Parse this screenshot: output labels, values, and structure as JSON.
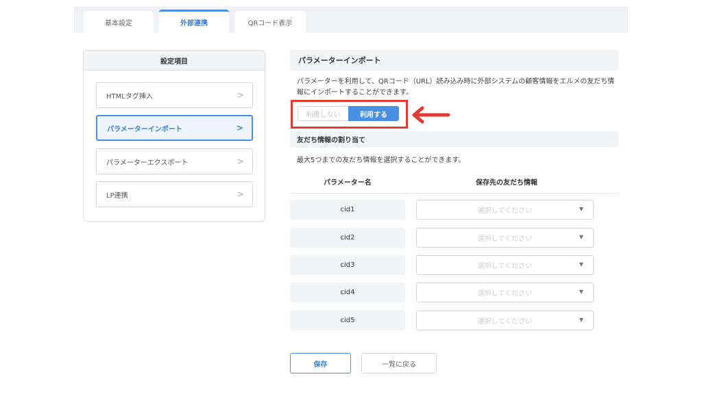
{
  "tabs": [
    {
      "label": "基本設定",
      "active": false
    },
    {
      "label": "外部連携",
      "active": true
    },
    {
      "label": "QRコード表示",
      "active": false
    }
  ],
  "sidebar": {
    "title": "設定項目",
    "items": [
      {
        "label": "HTMLタグ挿入",
        "active": false
      },
      {
        "label": "パラメーターインポート",
        "active": true
      },
      {
        "label": "パラメーターエクスポート",
        "active": false
      },
      {
        "label": "LP連携",
        "active": false
      }
    ],
    "chevron": ">"
  },
  "import_section": {
    "title": "パラメーターインポート",
    "description": "パラメーターを利用して、QRコード（URL）読み込み時に外部システムの顧客情報をエルメの友だち情報にインポートすることができます。",
    "toggle": {
      "off_label": "利用しない",
      "on_label": "利用する",
      "selected": "on"
    }
  },
  "assign_section": {
    "title": "友だち情報の割り当て",
    "description": "最大5つまでの友だち情報を選択することができます。",
    "col_param": "パラメーター名",
    "col_target": "保存先の友だち情報",
    "rows": [
      {
        "param": "cid1",
        "placeholder": "選択してください"
      },
      {
        "param": "cid2",
        "placeholder": "選択してください"
      },
      {
        "param": "cid3",
        "placeholder": "選択してください"
      },
      {
        "param": "cid4",
        "placeholder": "選択してください"
      },
      {
        "param": "cid5",
        "placeholder": "選択してください"
      }
    ]
  },
  "buttons": {
    "save": "保存",
    "back": "一覧に戻る"
  },
  "colors": {
    "accent": "#4a90e2",
    "highlight": "#e53935"
  }
}
